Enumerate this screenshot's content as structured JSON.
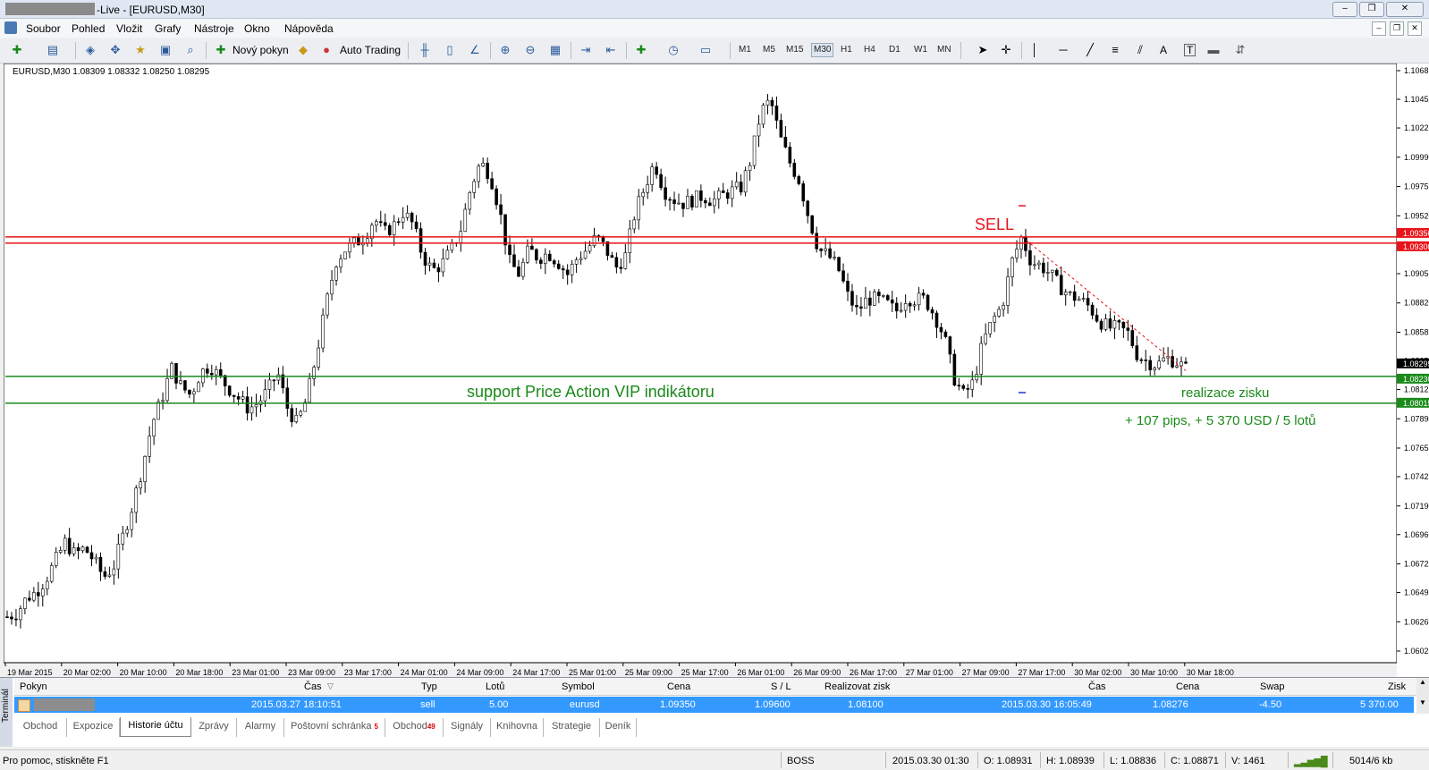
{
  "window": {
    "title": "-Live - [EURUSD,M30]",
    "controls": [
      "–",
      "❐",
      "✕"
    ]
  },
  "menu": [
    "Soubor",
    "Pohled",
    "Vložit",
    "Grafy",
    "Nástroje",
    "Okno",
    "Nápověda"
  ],
  "toolbar": {
    "new_order": "Nový pokyn",
    "auto_trading": "Auto Trading",
    "timeframes": [
      "M1",
      "M5",
      "M15",
      "M30",
      "H1",
      "H4",
      "D1",
      "W1",
      "MN"
    ],
    "active_timeframe": "M30",
    "draw_tools": [
      "A",
      "T"
    ]
  },
  "chart": {
    "symbol_info": "EURUSD,M30  1.08309 1.08332 1.08250 1.08295",
    "price_labels": [
      "1.10685",
      "1.10455",
      "1.10225",
      "1.09990",
      "1.09755",
      "1.09520",
      "1.09055",
      "1.08820",
      "1.08585",
      "1.08355",
      "1.08125",
      "1.07890",
      "1.07655",
      "1.07425",
      "1.07190",
      "1.06960",
      "1.06725",
      "1.06495",
      "1.06260",
      "1.06025"
    ],
    "highlight_labels": [
      {
        "text": "1.09350",
        "color": "#e8141a"
      },
      {
        "text": "1.09300",
        "color": "#e8141a"
      },
      {
        "text": "1.08295",
        "color": "#000000"
      },
      {
        "text": "1.08230",
        "color": "#1a8a1a"
      },
      {
        "text": "1.08015",
        "color": "#1a8a1a"
      }
    ],
    "time_labels": [
      "19 Mar 2015",
      "20 Mar 02:00",
      "20 Mar 10:00",
      "20 Mar 18:00",
      "23 Mar 01:00",
      "23 Mar 09:00",
      "23 Mar 17:00",
      "24 Mar 01:00",
      "24 Mar 09:00",
      "24 Mar 17:00",
      "25 Mar 01:00",
      "25 Mar 09:00",
      "25 Mar 17:00",
      "26 Mar 01:00",
      "26 Mar 09:00",
      "26 Mar 17:00",
      "27 Mar 01:00",
      "27 Mar 09:00",
      "27 Mar 17:00",
      "30 Mar 02:00",
      "30 Mar 10:00",
      "30 Mar 18:00"
    ],
    "annotations": {
      "sell": "SELL",
      "support": "support Price Action VIP indikátoru",
      "profit_take": "realizace zisku",
      "result": "+ 107 pips, + 5 370 USD / 5 lotů"
    },
    "levels": {
      "resistance_high": 1.0935,
      "resistance_low": 1.093,
      "support_high": 1.0823,
      "support_low": 1.08015
    },
    "colors": {
      "bull": "#ffffff",
      "bear": "#000000",
      "red_line": "#e8141a",
      "green_line": "#1a8a1a"
    }
  },
  "chart_data": {
    "type": "candlestick",
    "symbol": "EURUSD",
    "timeframe": "M30",
    "ylim": [
      1.06025,
      1.10685
    ],
    "x_ticks": [
      "19 Mar 2015",
      "20 Mar 02:00",
      "20 Mar 10:00",
      "20 Mar 18:00",
      "23 Mar 01:00",
      "23 Mar 09:00",
      "23 Mar 17:00",
      "24 Mar 01:00",
      "24 Mar 09:00",
      "24 Mar 17:00",
      "25 Mar 01:00",
      "25 Mar 09:00",
      "25 Mar 17:00",
      "26 Mar 01:00",
      "26 Mar 09:00",
      "26 Mar 17:00",
      "27 Mar 01:00",
      "27 Mar 09:00",
      "27 Mar 17:00",
      "30 Mar 02:00",
      "30 Mar 10:00",
      "30 Mar 18:00"
    ],
    "close_path": [
      1.063,
      1.0633,
      1.0645,
      1.065,
      1.066,
      1.0675,
      1.069,
      1.068,
      1.0685,
      1.0675,
      1.0662,
      1.067,
      1.0695,
      1.072,
      1.075,
      1.0785,
      1.0805,
      1.083,
      1.0815,
      1.0808,
      1.0826,
      1.0832,
      1.0822,
      1.0813,
      1.0805,
      1.0797,
      1.0802,
      1.0812,
      1.0826,
      1.0798,
      1.0785,
      1.0805,
      1.084,
      1.088,
      1.0915,
      1.0925,
      1.093,
      1.0935,
      1.095,
      1.0938,
      1.0944,
      1.0955,
      1.0945,
      1.092,
      1.0908,
      1.0913,
      1.0925,
      1.0942,
      1.0975,
      1.0995,
      1.0985,
      1.0955,
      1.0915,
      1.0905,
      1.0925,
      1.0918,
      1.0922,
      1.0915,
      1.0905,
      1.0918,
      1.0925,
      1.0935,
      1.0925,
      1.091,
      1.092,
      1.0955,
      1.0975,
      1.0995,
      1.0972,
      1.0965,
      1.0962,
      1.0965,
      1.0968,
      1.0964,
      1.0968,
      1.0972,
      1.0975,
      1.0998,
      1.1035,
      1.1045,
      1.1015,
      1.0995,
      1.098,
      1.095,
      1.0925,
      1.092,
      1.091,
      1.0888,
      1.0875,
      1.0885,
      1.0885,
      1.0882,
      1.0875,
      1.0886,
      1.0885,
      1.0885,
      1.0872,
      1.0855,
      1.0822,
      1.0808,
      1.0818,
      1.085,
      1.0868,
      1.088,
      1.0915,
      1.0935,
      1.0915,
      1.0912,
      1.0905,
      1.0895,
      1.0888,
      1.0885,
      1.0879,
      1.0868,
      1.0862,
      1.0862,
      1.0858,
      1.084,
      1.0835,
      1.0832,
      1.0838,
      1.0835,
      1.0829
    ],
    "horizontal_lines": [
      1.0935,
      1.093,
      1.0823,
      1.08015
    ],
    "last_price": 1.08295
  },
  "terminal": {
    "side_label": "Terminál",
    "headers": [
      "Pokyn",
      "Čas",
      "Typ",
      "Lotů",
      "Symbol",
      "Cena",
      "S / L",
      "Realizovat zisk",
      "Čas",
      "Cena",
      "Swap",
      "Zisk"
    ],
    "row": {
      "time_open": "2015.03.27 18:10:51",
      "type": "sell",
      "lots": "5.00",
      "symbol": "eurusd",
      "price_open": "1.09350",
      "sl": "1.09600",
      "tp": "1.08100",
      "time_close": "2015.03.30 16:05:49",
      "price_close": "1.08276",
      "swap": "-4.50",
      "profit": "5 370.00"
    },
    "tabs": [
      {
        "label": "Obchod"
      },
      {
        "label": "Expozice"
      },
      {
        "label": "Historie účtu",
        "active": true
      },
      {
        "label": "Zprávy"
      },
      {
        "label": "Alarmy"
      },
      {
        "label": "Poštovní schránka",
        "badge": "5"
      },
      {
        "label": "Obchod",
        "badge": "49"
      },
      {
        "label": "Signály"
      },
      {
        "label": "Knihovna"
      },
      {
        "label": "Strategie"
      },
      {
        "label": "Deník"
      }
    ]
  },
  "status": {
    "help": "Pro pomoc, stiskněte F1",
    "profile": "BOSS",
    "datetime": "2015.03.30 01:30",
    "open": "O: 1.08931",
    "high": "H: 1.08939",
    "low": "L: 1.08836",
    "close": "C: 1.08871",
    "volume": "V: 1461",
    "traffic": "5014/6 kb"
  }
}
